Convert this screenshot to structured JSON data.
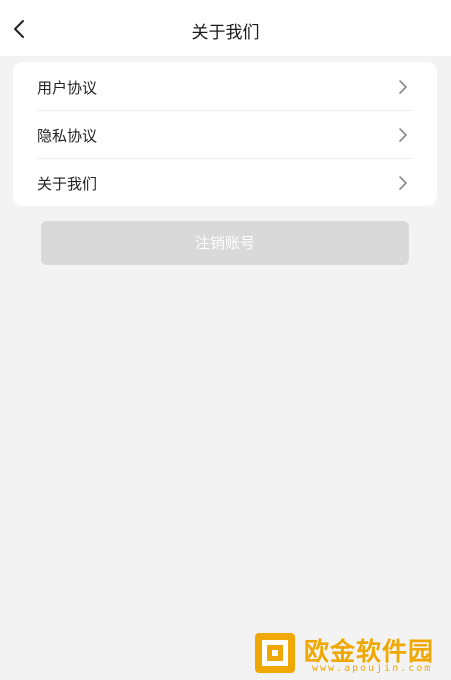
{
  "header": {
    "title": "关于我们",
    "back_icon": "chevron-left-icon"
  },
  "menu": {
    "items": [
      {
        "label": "用户协议",
        "icon": "chevron-right-icon"
      },
      {
        "label": "隐私协议",
        "icon": "chevron-right-icon"
      },
      {
        "label": "关于我们",
        "icon": "chevron-right-icon"
      }
    ]
  },
  "cancel_account": {
    "label": "注销账号",
    "enabled": false
  },
  "watermark": {
    "text": "欧金软件园",
    "url": "www.apoujin.com",
    "color": "#f0a800"
  }
}
